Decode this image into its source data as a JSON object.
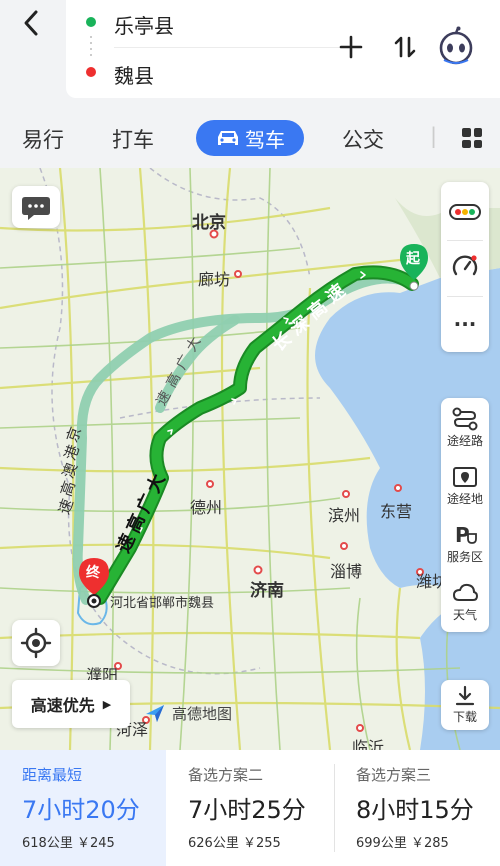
{
  "route": {
    "start": "乐亭县",
    "end": "魏县"
  },
  "tabs": [
    {
      "label": "易行"
    },
    {
      "label": "打车"
    },
    {
      "label": "驾车"
    },
    {
      "label": "公交"
    }
  ],
  "map": {
    "labels": {
      "beijing": "北京",
      "langfang": "廊坊",
      "dezhou": "德州",
      "binzhou": "滨州",
      "dongying": "东营",
      "jinan": "济南",
      "zibo": "淄博",
      "weifang": "潍坊",
      "puyang": "濮阳",
      "heze": "菏泽",
      "linyi": "临沂",
      "destination": "河北省邯郸市魏县"
    },
    "road_labels": {
      "changshen": [
        "长",
        "深",
        "高",
        "速"
      ],
      "daguang_light": [
        "大",
        "广",
        "高",
        "速"
      ],
      "daguang_main": [
        "大",
        "广",
        "高",
        "速"
      ],
      "jinggangao": [
        "京",
        "港",
        "澳",
        "高",
        "速"
      ]
    },
    "start_marker": "起",
    "end_marker": "终",
    "attribution": "高德地图"
  },
  "side_panel": {
    "waypoint_road": "途经路",
    "waypoint_place": "途经地",
    "service_area": "服务区",
    "weather": "天气",
    "download": "下载"
  },
  "preference": {
    "label": "高速优先"
  },
  "plans": [
    {
      "tag": "距离最短",
      "time": "7小时20分",
      "info": "618公里 ￥245"
    },
    {
      "tag": "备选方案二",
      "time": "7小时25分",
      "info": "626公里 ￥255"
    },
    {
      "tag": "备选方案三",
      "time": "8小时15分",
      "info": "699公里 ￥285"
    }
  ],
  "colors": {
    "accent": "#3a78f2",
    "route_main": "#22a42c",
    "route_alt": "#8fcfb0",
    "start_green": "#19b35a",
    "end_red": "#ee2f2f"
  }
}
